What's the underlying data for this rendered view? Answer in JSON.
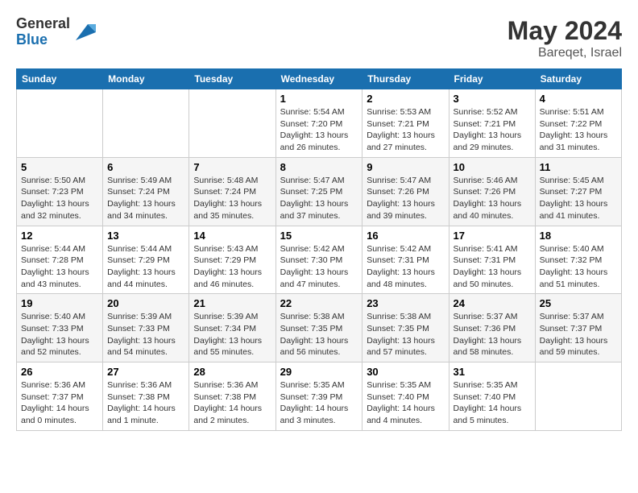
{
  "header": {
    "logo_general": "General",
    "logo_blue": "Blue",
    "month_year": "May 2024",
    "location": "Bareqet, Israel"
  },
  "weekdays": [
    "Sunday",
    "Monday",
    "Tuesday",
    "Wednesday",
    "Thursday",
    "Friday",
    "Saturday"
  ],
  "weeks": [
    [
      {
        "day": "",
        "info": ""
      },
      {
        "day": "",
        "info": ""
      },
      {
        "day": "",
        "info": ""
      },
      {
        "day": "1",
        "info": "Sunrise: 5:54 AM\nSunset: 7:20 PM\nDaylight: 13 hours\nand 26 minutes."
      },
      {
        "day": "2",
        "info": "Sunrise: 5:53 AM\nSunset: 7:21 PM\nDaylight: 13 hours\nand 27 minutes."
      },
      {
        "day": "3",
        "info": "Sunrise: 5:52 AM\nSunset: 7:21 PM\nDaylight: 13 hours\nand 29 minutes."
      },
      {
        "day": "4",
        "info": "Sunrise: 5:51 AM\nSunset: 7:22 PM\nDaylight: 13 hours\nand 31 minutes."
      }
    ],
    [
      {
        "day": "5",
        "info": "Sunrise: 5:50 AM\nSunset: 7:23 PM\nDaylight: 13 hours\nand 32 minutes."
      },
      {
        "day": "6",
        "info": "Sunrise: 5:49 AM\nSunset: 7:24 PM\nDaylight: 13 hours\nand 34 minutes."
      },
      {
        "day": "7",
        "info": "Sunrise: 5:48 AM\nSunset: 7:24 PM\nDaylight: 13 hours\nand 35 minutes."
      },
      {
        "day": "8",
        "info": "Sunrise: 5:47 AM\nSunset: 7:25 PM\nDaylight: 13 hours\nand 37 minutes."
      },
      {
        "day": "9",
        "info": "Sunrise: 5:47 AM\nSunset: 7:26 PM\nDaylight: 13 hours\nand 39 minutes."
      },
      {
        "day": "10",
        "info": "Sunrise: 5:46 AM\nSunset: 7:26 PM\nDaylight: 13 hours\nand 40 minutes."
      },
      {
        "day": "11",
        "info": "Sunrise: 5:45 AM\nSunset: 7:27 PM\nDaylight: 13 hours\nand 41 minutes."
      }
    ],
    [
      {
        "day": "12",
        "info": "Sunrise: 5:44 AM\nSunset: 7:28 PM\nDaylight: 13 hours\nand 43 minutes."
      },
      {
        "day": "13",
        "info": "Sunrise: 5:44 AM\nSunset: 7:29 PM\nDaylight: 13 hours\nand 44 minutes."
      },
      {
        "day": "14",
        "info": "Sunrise: 5:43 AM\nSunset: 7:29 PM\nDaylight: 13 hours\nand 46 minutes."
      },
      {
        "day": "15",
        "info": "Sunrise: 5:42 AM\nSunset: 7:30 PM\nDaylight: 13 hours\nand 47 minutes."
      },
      {
        "day": "16",
        "info": "Sunrise: 5:42 AM\nSunset: 7:31 PM\nDaylight: 13 hours\nand 48 minutes."
      },
      {
        "day": "17",
        "info": "Sunrise: 5:41 AM\nSunset: 7:31 PM\nDaylight: 13 hours\nand 50 minutes."
      },
      {
        "day": "18",
        "info": "Sunrise: 5:40 AM\nSunset: 7:32 PM\nDaylight: 13 hours\nand 51 minutes."
      }
    ],
    [
      {
        "day": "19",
        "info": "Sunrise: 5:40 AM\nSunset: 7:33 PM\nDaylight: 13 hours\nand 52 minutes."
      },
      {
        "day": "20",
        "info": "Sunrise: 5:39 AM\nSunset: 7:33 PM\nDaylight: 13 hours\nand 54 minutes."
      },
      {
        "day": "21",
        "info": "Sunrise: 5:39 AM\nSunset: 7:34 PM\nDaylight: 13 hours\nand 55 minutes."
      },
      {
        "day": "22",
        "info": "Sunrise: 5:38 AM\nSunset: 7:35 PM\nDaylight: 13 hours\nand 56 minutes."
      },
      {
        "day": "23",
        "info": "Sunrise: 5:38 AM\nSunset: 7:35 PM\nDaylight: 13 hours\nand 57 minutes."
      },
      {
        "day": "24",
        "info": "Sunrise: 5:37 AM\nSunset: 7:36 PM\nDaylight: 13 hours\nand 58 minutes."
      },
      {
        "day": "25",
        "info": "Sunrise: 5:37 AM\nSunset: 7:37 PM\nDaylight: 13 hours\nand 59 minutes."
      }
    ],
    [
      {
        "day": "26",
        "info": "Sunrise: 5:36 AM\nSunset: 7:37 PM\nDaylight: 14 hours\nand 0 minutes."
      },
      {
        "day": "27",
        "info": "Sunrise: 5:36 AM\nSunset: 7:38 PM\nDaylight: 14 hours\nand 1 minute."
      },
      {
        "day": "28",
        "info": "Sunrise: 5:36 AM\nSunset: 7:38 PM\nDaylight: 14 hours\nand 2 minutes."
      },
      {
        "day": "29",
        "info": "Sunrise: 5:35 AM\nSunset: 7:39 PM\nDaylight: 14 hours\nand 3 minutes."
      },
      {
        "day": "30",
        "info": "Sunrise: 5:35 AM\nSunset: 7:40 PM\nDaylight: 14 hours\nand 4 minutes."
      },
      {
        "day": "31",
        "info": "Sunrise: 5:35 AM\nSunset: 7:40 PM\nDaylight: 14 hours\nand 5 minutes."
      },
      {
        "day": "",
        "info": ""
      }
    ]
  ]
}
